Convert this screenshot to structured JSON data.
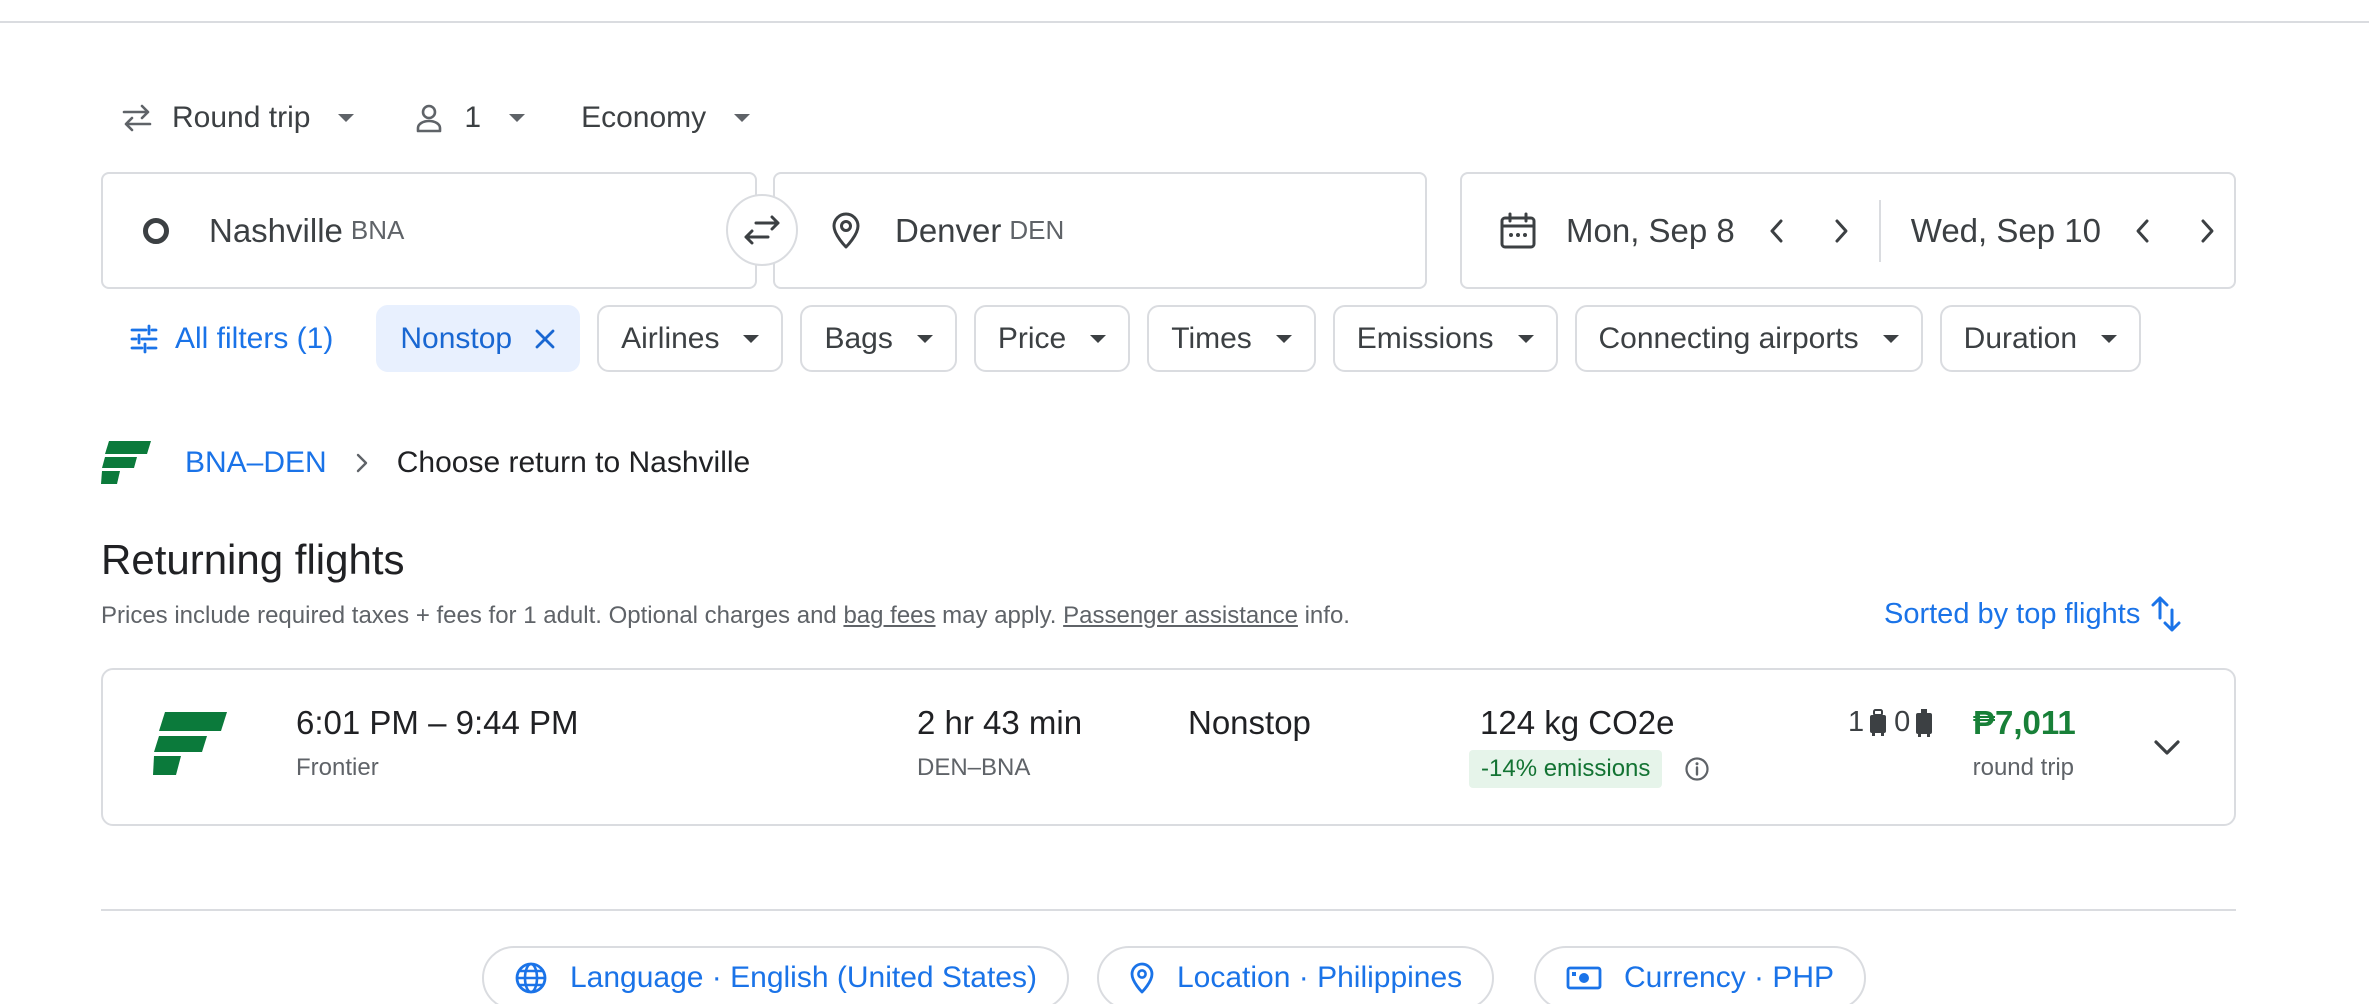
{
  "trip_options": {
    "trip_type": "Round trip",
    "passengers": "1",
    "cabin": "Economy"
  },
  "search": {
    "origin_city": "Nashville",
    "origin_code": "BNA",
    "destination_city": "Denver",
    "destination_code": "DEN",
    "depart_date": "Mon, Sep 8",
    "return_date": "Wed, Sep 10"
  },
  "filters": {
    "all_filters": "All filters (1)",
    "nonstop": "Nonstop",
    "airlines": "Airlines",
    "bags": "Bags",
    "price": "Price",
    "times": "Times",
    "emissions": "Emissions",
    "connecting_airports": "Connecting airports",
    "duration": "Duration"
  },
  "breadcrumb": {
    "leg": "BNA–DEN",
    "current": "Choose return to Nashville"
  },
  "section": {
    "title": "Returning flights",
    "note_prefix": "Prices include required taxes + fees for 1 adult. Optional charges and ",
    "bag_fees": "bag fees",
    "note_middle": " may apply. ",
    "passenger_assistance": "Passenger assistance",
    "note_suffix": " info.",
    "sort_label": "Sorted by top flights"
  },
  "flights": [
    {
      "times": "6:01 PM – 9:44 PM",
      "airline": "Frontier",
      "duration": "2 hr 43 min",
      "route": "DEN–BNA",
      "stops": "Nonstop",
      "co2": "124 kg CO2e",
      "emissions_badge": "-14% emissions",
      "carry_on": "1",
      "checked": "0",
      "price": "₱7,011",
      "price_type": "round trip"
    }
  ],
  "footer": {
    "language": "Language · English (United States)",
    "location": "Location · Philippines",
    "currency": "Currency · PHP"
  },
  "colors": {
    "accent": "#1a73e8",
    "price_green": "#188038",
    "frontier_green": "#0b7a3b",
    "emissions_bg": "#e6f4ea"
  }
}
